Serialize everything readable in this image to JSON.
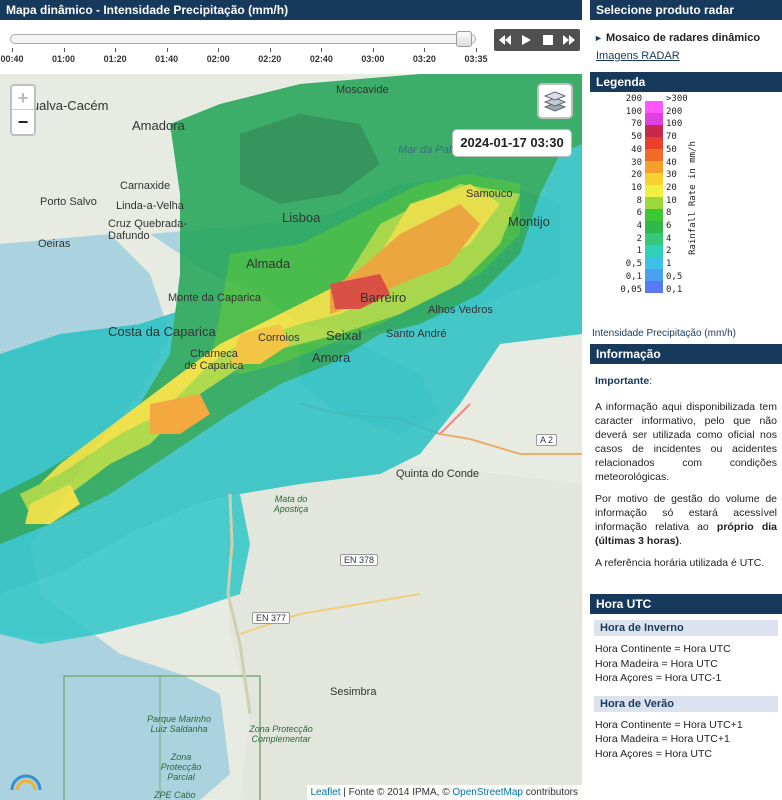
{
  "left_panel": {
    "title": "Mapa dinâmico - Intensidade Precipitação (mm/h)"
  },
  "timeline": {
    "ticks": [
      "00:40",
      "01:00",
      "01:20",
      "01:40",
      "02:00",
      "02:20",
      "02:40",
      "03:00",
      "03:20",
      "03:35"
    ],
    "position_fraction": 1.0
  },
  "controls": {
    "icons": [
      "rewind-icon",
      "play-icon",
      "stop-icon",
      "fast-forward-icon"
    ]
  },
  "map": {
    "zoom_in": "+",
    "zoom_out": "−",
    "timestamp": "2024-01-17 03:30",
    "attribution": {
      "leaflet": "Leaflet",
      "sep": " | Fonte © 2014 IPMA, © ",
      "osm": "OpenStreetMap",
      "suffix": " contributors"
    },
    "places": {
      "agualva_cacem": "Agualva-Cacém",
      "amadora": "Amadora",
      "moscavide": "Moscavide",
      "carnaxide": "Carnaxide",
      "porto_salvo": "Porto Salvo",
      "linda_a_velha": "Linda-a-Velha",
      "cruz_quebrada": "Cruz Quebrada-Dafundo",
      "oeiras": "Oeiras",
      "lisboa": "Lisboa",
      "mar_da_palha": "Mar da Palha",
      "samouco": "Samouco",
      "montijo": "Montijo",
      "almada": "Almada",
      "barreiro": "Barreiro",
      "alhos_vedros": "Alhos Vedros",
      "monte_da_caparica": "Monte da Caparica",
      "costa_da_caparica": "Costa da Caparica",
      "seixal": "Seixal",
      "santo_andre": "Santo André",
      "corroios": "Corroios",
      "charneca": "Charneca de Caparica",
      "amora": "Amora",
      "quinta_do_conde": "Quinta do Conde",
      "mata_apostica": "Mata do Apostiça",
      "en378": "EN 378",
      "en377": "EN 377",
      "sesimbra": "Sesimbra",
      "parque_marinho": "Parque Marinho Luiz Saldanha",
      "zona_protecao": "Zona Protecção Parcial",
      "zona_complementar": "Zona Protecção Complementar",
      "zpe_cabo": "ZPE Cabo",
      "a2": "A 2"
    }
  },
  "right_panel": {
    "product_title": "Selecione produto radar",
    "product_selected": "Mosaico de radares dinâmico",
    "images_link": "Imagens RADAR",
    "legend_title": "Legenda",
    "legend": {
      "left_labels": [
        "200",
        "100",
        "70",
        "50",
        "40",
        "30",
        "20",
        "10",
        "8",
        "6",
        "4",
        "2",
        "1",
        "0,5",
        "0,1",
        "0,05"
      ],
      "right_labels": [
        ">300",
        "200",
        "100",
        "70",
        "50",
        "40",
        "30",
        "20",
        "10",
        "8",
        "6",
        "4",
        "2",
        "1",
        "0,5",
        "0,1"
      ],
      "axis_label": "Rainfall Rate in mm/h",
      "caption": "Intensidade Precipitação (mm/h)",
      "colors": [
        "#ff55ff",
        "#e040e0",
        "#c8284c",
        "#e8402c",
        "#f06a28",
        "#f5a02a",
        "#f8d030",
        "#f0f040",
        "#9ad83c",
        "#3cc832",
        "#2eb84a",
        "#34c878",
        "#2ed0b8",
        "#3cc0e8",
        "#4aa0f0",
        "#5a7af5"
      ]
    },
    "info_title": "Informação",
    "info": {
      "important": "Importante",
      "important_colon": ":",
      "p1": "A informação aqui disponibilizada tem caracter informativo, pelo que não deverá ser utilizada como oficial nos casos de incidentes ou acidentes relacionados com condições meteorológicas.",
      "p2_a": "Por motivo de gestão do volume de informação só estará acessível informação relativa ao ",
      "p2_bold": "próprio dia (últimas 3 horas)",
      "p2_end": ".",
      "p3": "A referência horária utilizada é UTC."
    },
    "utc_title": "Hora UTC",
    "winter_title": "Hora de Inverno",
    "winter": [
      "Hora Continente = Hora UTC",
      "Hora Madeira = Hora UTC",
      "Hora Açores = Hora UTC-1"
    ],
    "summer_title": "Hora de Verão",
    "summer": [
      "Hora Continente = Hora UTC+1",
      "Hora Madeira = Hora UTC+1",
      "Hora Açores = Hora UTC"
    ]
  }
}
